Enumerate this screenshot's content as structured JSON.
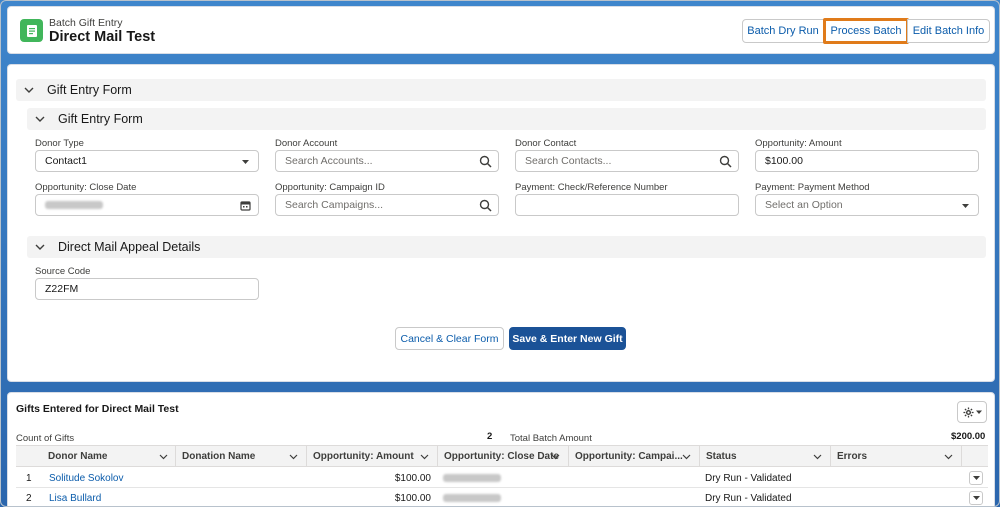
{
  "header": {
    "subtitle": "Batch Gift Entry",
    "title": "Direct Mail Test",
    "buttons": {
      "dry_run": "Batch Dry Run",
      "process": "Process Batch",
      "edit": "Edit Batch Info"
    }
  },
  "form": {
    "outer_section": "Gift Entry Form",
    "inner_section": "Gift Entry Form",
    "fields": {
      "donor_type": {
        "label": "Donor Type",
        "value": "Contact1"
      },
      "donor_account": {
        "label": "Donor Account",
        "placeholder": "Search Accounts..."
      },
      "donor_contact": {
        "label": "Donor Contact",
        "placeholder": "Search Contacts..."
      },
      "opp_amount": {
        "label": "Opportunity: Amount",
        "value": "$100.00"
      },
      "close_date": {
        "label": "Opportunity: Close Date"
      },
      "campaign_id": {
        "label": "Opportunity: Campaign ID",
        "placeholder": "Search Campaigns..."
      },
      "check_ref": {
        "label": "Payment: Check/Reference Number",
        "value": ""
      },
      "payment_method": {
        "label": "Payment: Payment Method",
        "value": "Select an Option"
      }
    },
    "appeal_section": "Direct Mail Appeal Details",
    "source_code": {
      "label": "Source Code",
      "value": "Z22FM"
    },
    "cancel_label": "Cancel & Clear Form",
    "save_label": "Save & Enter New Gift"
  },
  "gifts": {
    "title": "Gifts Entered for Direct Mail Test",
    "count_label": "Count of Gifts",
    "count_value": "2",
    "total_label": "Total Batch Amount",
    "total_value": "$200.00",
    "columns": [
      "Donor Name",
      "Donation Name",
      "Opportunity: Amount",
      "Opportunity: Close Date",
      "Opportunity: Campai...",
      "Status",
      "Errors"
    ],
    "rows": [
      {
        "num": "1",
        "donor": "Solitude Sokolov",
        "donation": "",
        "amount": "$100.00",
        "status": "Dry Run - Validated",
        "errors": ""
      },
      {
        "num": "2",
        "donor": "Lisa Bullard",
        "donation": "",
        "amount": "$100.00",
        "status": "Dry Run - Validated",
        "errors": ""
      }
    ]
  },
  "colors": {
    "accent": "#0b5cab",
    "brand_button": "#1b5297",
    "highlight": "#e07b1a",
    "app_icon": "#41b65b"
  },
  "icons": [
    "document-icon",
    "chevron-down-icon",
    "search-icon",
    "calendar-icon",
    "gear-icon",
    "caret-down-icon"
  ]
}
